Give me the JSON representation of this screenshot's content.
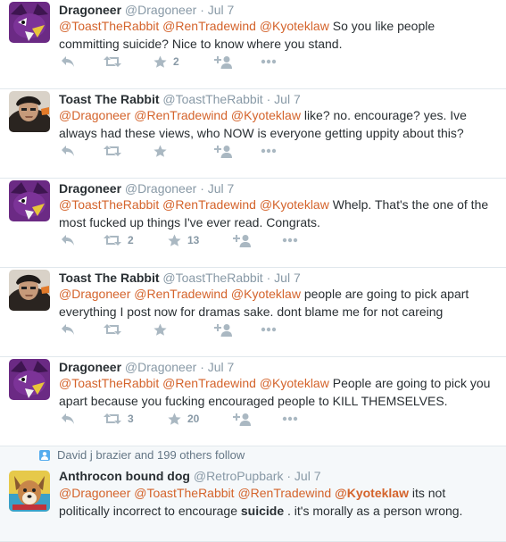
{
  "tweets": [
    {
      "name": "Dragoneer",
      "handle": "@Dragoneer",
      "time": "Jul 7",
      "mentions": [
        "@ToastTheRabbit",
        "@RenTradewind",
        "@Kyoteklaw"
      ],
      "text": "So you like people committing suicide? Nice to know where you stand.",
      "retweets": "",
      "favorites": "2"
    },
    {
      "name": "Toast The Rabbit",
      "handle": "@ToastTheRabbit",
      "time": "Jul 7",
      "mentions": [
        "@Dragoneer",
        "@RenTradewind",
        "@Kyoteklaw"
      ],
      "text": "like? no. encourage? yes. Ive always had these views, who NOW is everyone getting uppity about this?",
      "retweets": "",
      "favorites": ""
    },
    {
      "name": "Dragoneer",
      "handle": "@Dragoneer",
      "time": "Jul 7",
      "mentions": [
        "@ToastTheRabbit",
        "@RenTradewind",
        "@Kyoteklaw"
      ],
      "text": "Whelp. That's the one of the most fucked up things I've ever read. Congrats.",
      "retweets": "2",
      "favorites": "13"
    },
    {
      "name": "Toast The Rabbit",
      "handle": "@ToastTheRabbit",
      "time": "Jul 7",
      "mentions": [
        "@Dragoneer",
        "@RenTradewind",
        "@Kyoteklaw"
      ],
      "text": "people are going to pick apart everything I post now for dramas sake. dont blame me for not careing",
      "retweets": "",
      "favorites": ""
    },
    {
      "name": "Dragoneer",
      "handle": "@Dragoneer",
      "time": "Jul 7",
      "mentions": [
        "@ToastTheRabbit",
        "@RenTradewind",
        "@Kyoteklaw"
      ],
      "text": "People are going to pick you apart because you fucking encouraged people to KILL THEMSELVES.",
      "retweets": "3",
      "favorites": "20"
    }
  ],
  "last_tweet": {
    "context": "David j brazier and 199 others follow",
    "name": "Anthrocon bound dog",
    "handle": "@RetroPupbark",
    "time": "Jul 7",
    "mention1": "@Dragoneer",
    "mention2": "@ToastTheRabbit",
    "mention3": "@RenTradewind",
    "mention4": "@Kyoteklaw",
    "text_a": "its not politically incorrect to encourage",
    "keyword": "suicide",
    "text_b": ". it's morally as a person wrong."
  },
  "separator_dot": "·",
  "colors": {
    "mention": "#d4632b",
    "name": "#292f33",
    "meta": "#8899a6",
    "action_icon": "#aab8c2",
    "dragoneer_avatar_bg": "#6b2a84",
    "toast_avatar_bg": "#3a2a1e"
  },
  "icons": {
    "reply": "reply-icon",
    "retweet": "retweet-icon",
    "favorite": "star-icon",
    "follow": "follow-icon",
    "more": "more-icon",
    "context": "person-icon"
  }
}
